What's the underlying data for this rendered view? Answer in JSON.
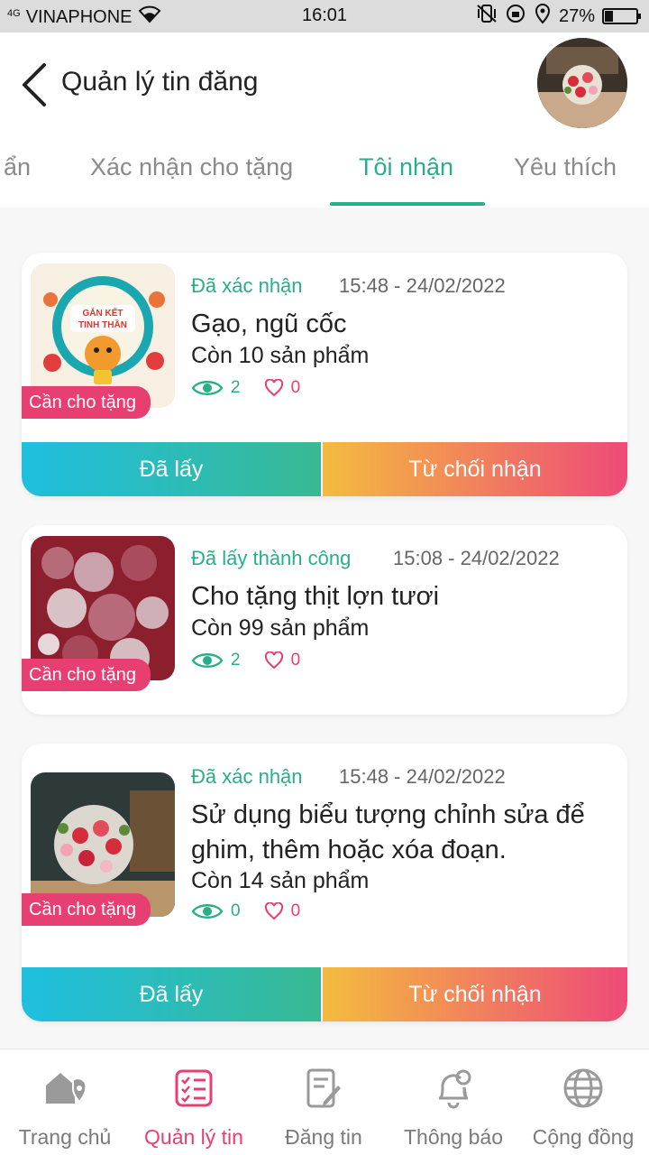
{
  "status_bar": {
    "network": "4G",
    "carrier": "VINAPHONE",
    "time": "16:01",
    "battery": "27%",
    "battery_level": 0.27
  },
  "header": {
    "title": "Quản lý tin đăng"
  },
  "tabs": [
    {
      "label": "ẩn"
    },
    {
      "label": "Xác nhận cho tặng"
    },
    {
      "label": "Tôi nhận",
      "active": true
    },
    {
      "label": "Yêu thích"
    }
  ],
  "posts": [
    {
      "badge": "Cần cho tặng",
      "status": "Đã xác nhận",
      "time": "15:48 - 24/02/2022",
      "title": "Gạo, ngũ cốc",
      "remaining": "Còn 10 sản phẩm",
      "views": "2",
      "likes": "0",
      "btn_taken": "Đã lấy",
      "btn_reject": "Từ chối nhận"
    },
    {
      "badge": "Cần cho tặng",
      "status": "Đã lấy thành công",
      "time": "15:08 - 24/02/2022",
      "title": "Cho tặng thịt lợn tươi",
      "remaining": "Còn 99 sản phẩm",
      "views": "2",
      "likes": "0"
    },
    {
      "badge": "Cần cho tặng",
      "status": "Đã xác nhận",
      "time": "15:48 - 24/02/2022",
      "title": "Sử dụng biểu tượng chỉnh sửa để ghim, thêm hoặc xóa đoạn.",
      "remaining": "Còn 14 sản phẩm",
      "views": "0",
      "likes": "0",
      "btn_taken": "Đã lấy",
      "btn_reject": "Từ chối nhận"
    }
  ],
  "thumb_texts": {
    "banner_line1": "GẮN KẾT",
    "banner_line2": "TINH THẦN"
  },
  "bottom_nav": [
    {
      "label": "Trang chủ",
      "icon": "home-location-icon"
    },
    {
      "label": "Quản lý tin",
      "icon": "checklist-icon",
      "active": true
    },
    {
      "label": "Đăng tin",
      "icon": "edit-document-icon"
    },
    {
      "label": "Thông báo",
      "icon": "bell-icon"
    },
    {
      "label": "Cộng đồng",
      "icon": "globe-icon"
    }
  ],
  "colors": {
    "accent_green": "#27ae8a",
    "accent_pink": "#e73f72",
    "muted_gray": "#8a8a8a"
  }
}
